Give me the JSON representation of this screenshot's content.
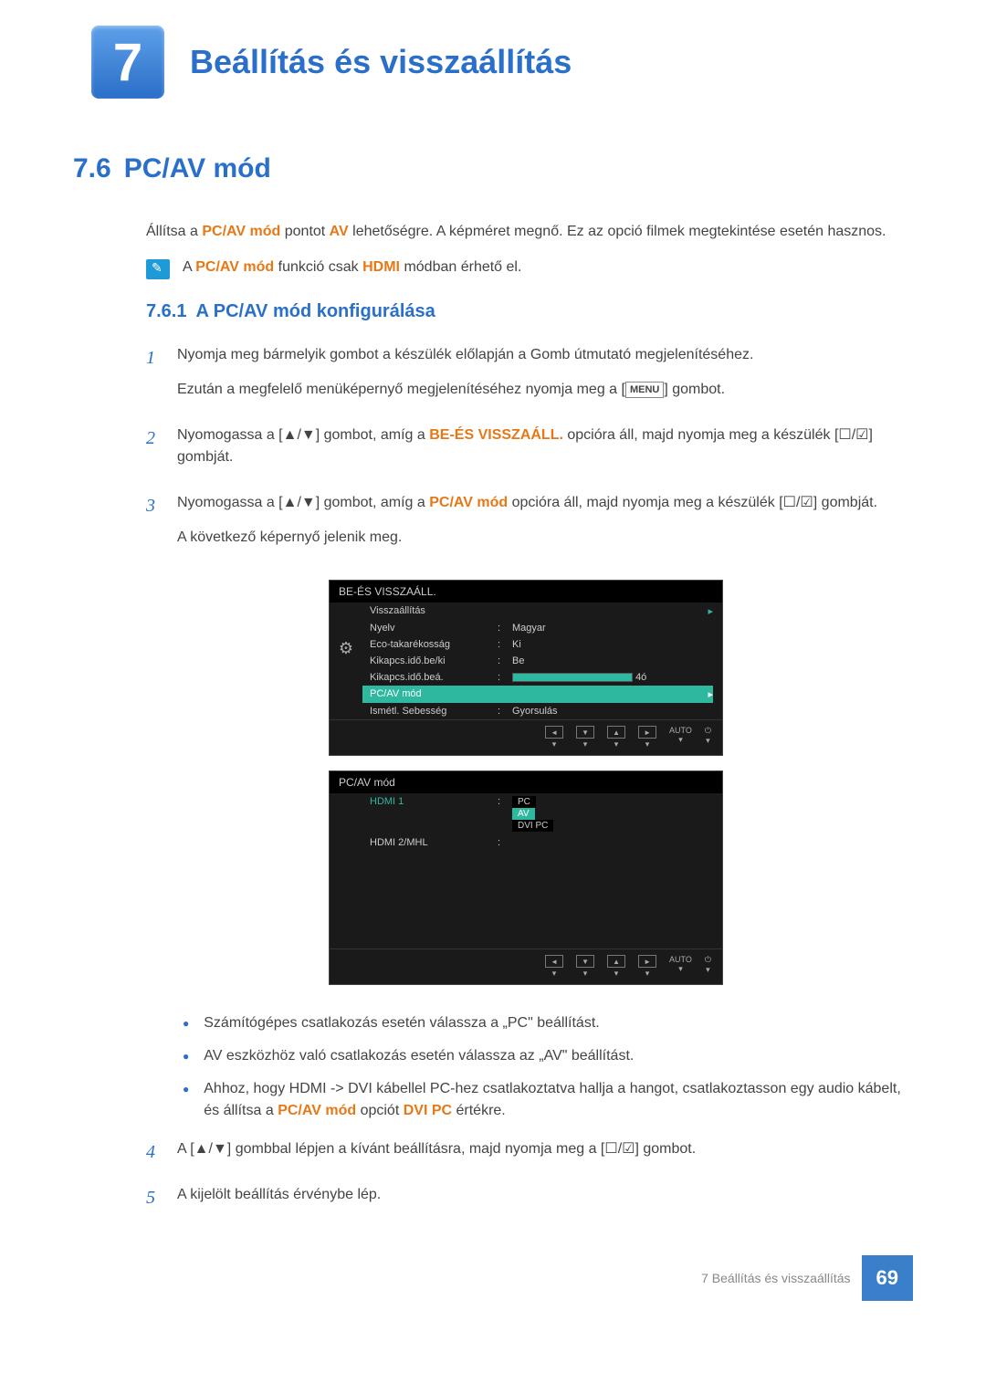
{
  "chapter": {
    "number": "7",
    "title": "Beállítás és visszaállítás"
  },
  "section": {
    "number": "7.6",
    "title": "PC/AV mód"
  },
  "intro": {
    "p1_pre": "Állítsa a ",
    "pcav": "PC/AV mód",
    "p1_mid": " pontot ",
    "av": "AV",
    "p1_post": " lehetőségre. A képméret megnő. Ez az opció filmek megtekintése esetén hasznos."
  },
  "note": {
    "pre": "A ",
    "pcav": "PC/AV mód",
    "mid": " funkció csak ",
    "hdmi": "HDMI",
    "post": " módban érhető el."
  },
  "subsection": {
    "number": "7.6.1",
    "title": "A PC/AV mód konfigurálása"
  },
  "steps": {
    "s1": {
      "n": "1",
      "p1": "Nyomja meg bármelyik gombot a készülék előlapján a Gomb útmutató megjelenítéséhez.",
      "p2_pre": "Ezután a megfelelő menüképernyő megjelenítéséhez nyomja meg a [",
      "menu": "MENU",
      "p2_post": "] gombot."
    },
    "s2": {
      "n": "2",
      "pre": "Nyomogassa a [▲/▼] gombot, amíg a ",
      "hl": "BE-ÉS VISSZAÁLL.",
      "post": " opcióra áll, majd nyomja meg a készülék [☐/☑] gombját."
    },
    "s3": {
      "n": "3",
      "pre": "Nyomogassa a [▲/▼] gombot, amíg a ",
      "hl": "PC/AV mód",
      "post": " opcióra áll, majd nyomja meg a készülék [☐/☑] gombját.",
      "p2": "A következő képernyő jelenik meg."
    },
    "s4": {
      "n": "4",
      "t": "A [▲/▼] gombbal lépjen a kívánt beállításra, majd nyomja meg a [☐/☑] gombot."
    },
    "s5": {
      "n": "5",
      "t": "A kijelölt beállítás érvénybe lép."
    }
  },
  "osd1": {
    "title": "BE-ÉS VISSZAÁLL.",
    "rows": [
      {
        "label": "Visszaállítás",
        "val": "",
        "arrow": true
      },
      {
        "label": "Nyelv",
        "val": "Magyar"
      },
      {
        "label": "Eco-takarékosság",
        "val": "Ki"
      },
      {
        "label": "Kikapcs.idő.be/ki",
        "val": "Be"
      },
      {
        "label": "Kikapcs.idő.beá.",
        "bar": true,
        "barval": "4ó"
      },
      {
        "label": "PC/AV mód",
        "hl": true,
        "arrow": true
      },
      {
        "label": "Ismétl. Sebesség",
        "val": "Gyorsulás"
      }
    ]
  },
  "osd2": {
    "title": "PC/AV mód",
    "rows": [
      {
        "label": "HDMI 1",
        "hl_label": true,
        "dropdown": [
          "PC",
          "AV",
          "DVI PC"
        ],
        "sel": 1
      },
      {
        "label": "HDMI 2/MHL",
        "val": ""
      }
    ]
  },
  "osd_footer": {
    "buttons": [
      "◄",
      "▼",
      "▲",
      "►"
    ],
    "auto": "AUTO",
    "power": "⏻"
  },
  "bullets": {
    "b1": "Számítógépes csatlakozás esetén válassza a „PC\" beállítást.",
    "b2": "AV eszközhöz való csatlakozás esetén válassza az „AV\" beállítást.",
    "b3_pre": "Ahhoz, hogy HDMI -> DVI kábellel PC-hez csatlakoztatva hallja a hangot, csatlakoztasson egy audio kábelt, és állítsa a ",
    "b3_pcav": "PC/AV mód",
    "b3_mid": " opciót ",
    "b3_dvi": "DVI PC",
    "b3_post": " értékre."
  },
  "footer": {
    "text": "7 Beállítás és visszaállítás",
    "page": "69"
  }
}
